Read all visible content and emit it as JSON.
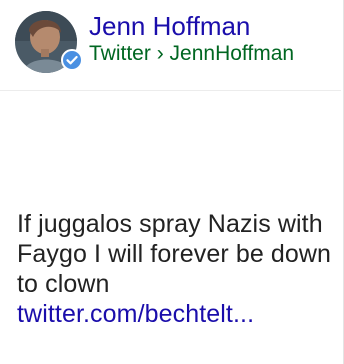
{
  "result": {
    "author": {
      "name": "Jenn Hoffman",
      "avatar_icon": "profile-photo",
      "verified_icon": "verified-check-icon",
      "verified_color": "#4a90e2"
    },
    "breadcrumb": {
      "site": "Twitter",
      "separator": "›",
      "handle": "JennHoffman"
    },
    "tweet": {
      "text": "If juggalos spray Nazis with Faygo I will forever be down to clown",
      "link": "twitter.com/bechtelt..."
    },
    "colors": {
      "link": "#1a0dab",
      "breadcrumb": "#006621",
      "body_text": "#222222"
    }
  }
}
